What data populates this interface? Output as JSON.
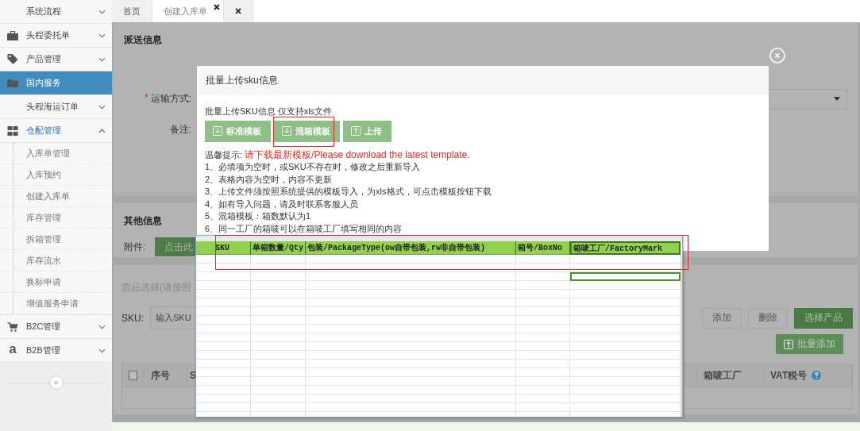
{
  "sidebar": {
    "items": [
      {
        "label": "系统流程",
        "kind": "plain",
        "expanded": false,
        "selected": false
      },
      {
        "label": "头程委托单",
        "kind": "briefcase",
        "expanded": false,
        "selected": false
      },
      {
        "label": "产品管理",
        "kind": "tag",
        "expanded": false,
        "selected": false
      },
      {
        "label": "国内服务",
        "kind": "folder",
        "selected": true
      },
      {
        "label": "头程海运订单",
        "kind": "plain",
        "expanded": false,
        "selected": false
      },
      {
        "label": "仓配管理",
        "kind": "grid",
        "expanded": true,
        "selected": false,
        "children": [
          {
            "label": "入库单管理",
            "selected": false
          },
          {
            "label": "入库预约",
            "selected": false
          },
          {
            "label": "创建入库单",
            "selected": false
          },
          {
            "label": "库存管理",
            "selected": false
          },
          {
            "label": "拆箱管理",
            "selected": false
          },
          {
            "label": "库存流水",
            "selected": false
          },
          {
            "label": "换标申请",
            "selected": false
          },
          {
            "label": "增值服务申请",
            "selected": false
          }
        ]
      },
      {
        "label": "B2C管理",
        "kind": "cart",
        "expanded": false,
        "selected": false
      },
      {
        "label": "B2B管理",
        "kind": "letter",
        "icon_glyph": "a",
        "expanded": false,
        "selected": false
      }
    ],
    "collapse_glyph": "«"
  },
  "tabs": [
    {
      "label": "首页",
      "selected": false,
      "closable": false
    },
    {
      "label": "创建入库单",
      "selected": true,
      "closable": true
    }
  ],
  "delivery": {
    "title": "派送信息",
    "rows": [
      [
        {
          "label": "运输方式:",
          "required_mark": "*",
          "kind": "select"
        }
      ],
      [
        {
          "label": "备注:",
          "kind": "none"
        }
      ]
    ]
  },
  "other": {
    "title": "其他信息",
    "attachment_label": "附件:",
    "attachment_button": "点击此"
  },
  "goods": {
    "hint": "货品选择(请按照",
    "sku_label": "SKU:",
    "sku_placeholder": "输入SKU",
    "buttons": [
      {
        "label": "添加",
        "kind": "plain"
      },
      {
        "label": "删除",
        "kind": "plain"
      },
      {
        "label": "选择产品",
        "kind": "primary"
      }
    ],
    "batch_button": "批量添加",
    "select_all": {
      "checked": false
    },
    "columns": [
      {
        "label": "序号",
        "kind": "text"
      },
      {
        "label": "S",
        "kind": "wide"
      },
      {
        "label": "箱唛工厂",
        "kind": "text"
      },
      {
        "label": "VAT税号",
        "kind": "help"
      }
    ]
  },
  "modal": {
    "title": "批量上传sku信息",
    "intro": "批量上传SKU信息 仅支持xls文件",
    "buttons": [
      {
        "label": "标准模板",
        "kind": "download"
      },
      {
        "label": "混箱模板",
        "kind": "download"
      },
      {
        "label": "上传",
        "kind": "upload"
      }
    ],
    "tip_label": "温馨提示:",
    "tip_warning": "请下载最新模板/Please download the latest template.",
    "tips": [
      "1、必填项为空时，或SKU不存在时，修改之后重新导入",
      "2、表格内容为空时，内容不更新",
      "3、上传文件须按照系统提供的模板导入，为xls格式，可点击模板按钮下载",
      "4、如有导入问题，请及时联系客服人员",
      "5、混箱模板：箱数默认为1",
      "6、同一工厂的箱唛可以在箱唛工厂填写相同的内容"
    ]
  },
  "spreadsheet": {
    "columns": [
      {
        "title": "SKU",
        "selected": false
      },
      {
        "title": "单箱数量/Qty",
        "selected": false
      },
      {
        "title": "包装/PackageType(ow自带包装,rw非自带包装)",
        "selected": false
      },
      {
        "title": "箱号/BoxNo",
        "selected": false
      },
      {
        "title": "箱唛工厂/FactoryMark",
        "selected": true
      }
    ]
  }
}
